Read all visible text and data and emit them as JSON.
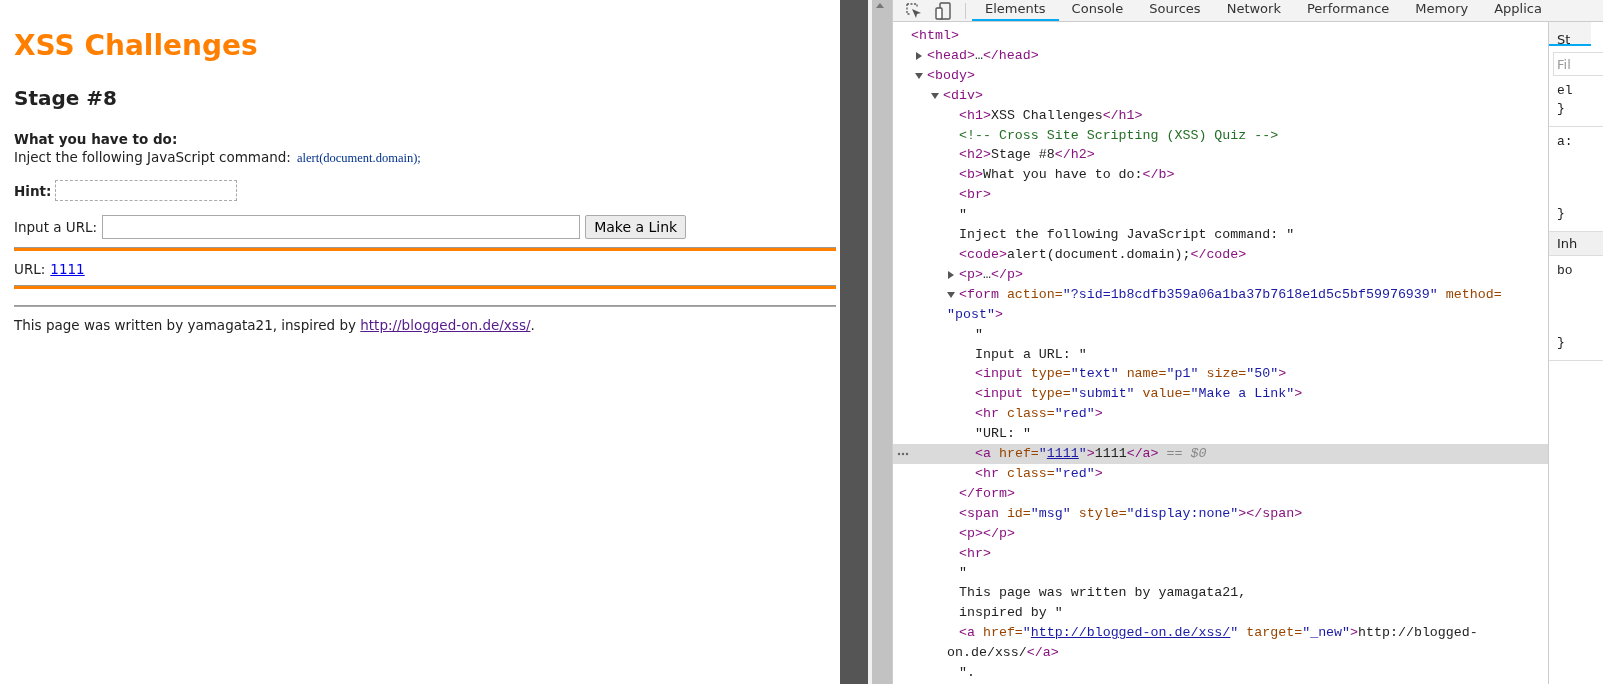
{
  "page": {
    "title": "XSS Challenges",
    "stage": "Stage #8",
    "task_label": "What you have to do:",
    "task_text": "Inject the following JavaScript command:",
    "task_code": "alert(document.domain);",
    "hint_label": "Hint:",
    "url_label": "Input a URL:",
    "button": "Make a Link",
    "result_label": "URL:",
    "result_link": "1111",
    "footer_text": "This page was written by yamagata21, inspired by",
    "footer_link": "http://blogged-on.de/xss/",
    "footer_end": "."
  },
  "devtools": {
    "tabs": [
      {
        "label": "Elements",
        "selected": true
      },
      {
        "label": "Console",
        "selected": false
      },
      {
        "label": "Sources",
        "selected": false
      },
      {
        "label": "Network",
        "selected": false
      },
      {
        "label": "Performance",
        "selected": false
      },
      {
        "label": "Memory",
        "selected": false
      },
      {
        "label": "Applica",
        "selected": false
      }
    ],
    "tree": [
      {
        "selected": false,
        "tokens": [
          {
            "kind": "tag",
            "text": "<html>"
          }
        ],
        "children": [
          {
            "selected": false,
            "expanded": false,
            "tokens": [
              {
                "kind": "tag",
                "text": "<head>"
              },
              {
                "kind": "text",
                "text": "…"
              },
              {
                "kind": "tag",
                "text": "</head>"
              }
            ]
          },
          {
            "selected": false,
            "expanded": true,
            "tokens": [
              {
                "kind": "tag",
                "text": "<body>"
              }
            ],
            "children": [
              {
                "selected": false,
                "expanded": true,
                "tokens": [
                  {
                    "kind": "tag",
                    "text": "<div>"
                  }
                ],
                "children": [
                  {
                    "selected": false,
                    "tokens": [
                      {
                        "kind": "tag",
                        "text": "<h1>"
                      },
                      {
                        "kind": "text",
                        "text": "XSS Challenges"
                      },
                      {
                        "kind": "tag",
                        "text": "</h1>"
                      }
                    ]
                  },
                  {
                    "selected": false,
                    "tokens": [
                      {
                        "kind": "comment",
                        "text": "<!-- Cross Site Scripting (XSS) Quiz -->"
                      }
                    ]
                  },
                  {
                    "selected": false,
                    "tokens": [
                      {
                        "kind": "tag",
                        "text": "<h2>"
                      },
                      {
                        "kind": "text",
                        "text": "Stage #8"
                      },
                      {
                        "kind": "tag",
                        "text": "</h2>"
                      }
                    ]
                  },
                  {
                    "selected": false,
                    "tokens": [
                      {
                        "kind": "tag",
                        "text": "<b>"
                      },
                      {
                        "kind": "text",
                        "text": "What you have to do:"
                      },
                      {
                        "kind": "tag",
                        "text": "</b>"
                      }
                    ]
                  },
                  {
                    "selected": false,
                    "tokens": [
                      {
                        "kind": "tag",
                        "text": "<br>"
                      }
                    ]
                  },
                  {
                    "selected": false,
                    "tokens": [
                      {
                        "kind": "text",
                        "text": "\""
                      }
                    ]
                  },
                  {
                    "selected": false,
                    "tokens": [
                      {
                        "kind": "text",
                        "text": "Inject the following JavaScript command: \""
                      }
                    ]
                  },
                  {
                    "selected": false,
                    "tokens": [
                      {
                        "kind": "tag",
                        "text": "<code>"
                      },
                      {
                        "kind": "text",
                        "text": "alert(document.domain);"
                      },
                      {
                        "kind": "tag",
                        "text": "</code>"
                      }
                    ]
                  },
                  {
                    "selected": false,
                    "expanded": false,
                    "tokens": [
                      {
                        "kind": "tag",
                        "text": "<p>"
                      },
                      {
                        "kind": "text",
                        "text": "…"
                      },
                      {
                        "kind": "tag",
                        "text": "</p>"
                      }
                    ]
                  },
                  {
                    "selected": false,
                    "expanded": true,
                    "tokens": [
                      {
                        "kind": "tag",
                        "text": "<form "
                      },
                      {
                        "kind": "attr",
                        "text": "action="
                      },
                      {
                        "kind": "value",
                        "text": "\"?sid=1b8cdfb359a06a1ba37b7618e1d5c5bf59976939\""
                      },
                      {
                        "kind": "attr",
                        "text": " method="
                      },
                      {
                        "kind": "value",
                        "text": "\"post\""
                      },
                      {
                        "kind": "tag",
                        "text": ">"
                      }
                    ],
                    "close": "</form>",
                    "children": [
                      {
                        "selected": false,
                        "tokens": [
                          {
                            "kind": "text",
                            "text": "\""
                          }
                        ]
                      },
                      {
                        "selected": false,
                        "tokens": [
                          {
                            "kind": "text",
                            "text": "Input a URL: \""
                          }
                        ]
                      },
                      {
                        "selected": false,
                        "tokens": [
                          {
                            "kind": "tag",
                            "text": "<input "
                          },
                          {
                            "kind": "attr",
                            "text": "type="
                          },
                          {
                            "kind": "value",
                            "text": "\"text\""
                          },
                          {
                            "kind": "attr",
                            "text": " name="
                          },
                          {
                            "kind": "value",
                            "text": "\"p1\""
                          },
                          {
                            "kind": "attr",
                            "text": " size="
                          },
                          {
                            "kind": "value",
                            "text": "\"50\""
                          },
                          {
                            "kind": "tag",
                            "text": ">"
                          }
                        ]
                      },
                      {
                        "selected": false,
                        "tokens": [
                          {
                            "kind": "tag",
                            "text": "<input "
                          },
                          {
                            "kind": "attr",
                            "text": "type="
                          },
                          {
                            "kind": "value",
                            "text": "\"submit\""
                          },
                          {
                            "kind": "attr",
                            "text": " value="
                          },
                          {
                            "kind": "value",
                            "text": "\"Make a Link\""
                          },
                          {
                            "kind": "tag",
                            "text": ">"
                          }
                        ]
                      },
                      {
                        "selected": false,
                        "tokens": [
                          {
                            "kind": "tag",
                            "text": "<hr "
                          },
                          {
                            "kind": "attr",
                            "text": "class="
                          },
                          {
                            "kind": "value",
                            "text": "\"red\""
                          },
                          {
                            "kind": "tag",
                            "text": ">"
                          }
                        ]
                      },
                      {
                        "selected": false,
                        "tokens": [
                          {
                            "kind": "text",
                            "text": "\"URL: \""
                          }
                        ]
                      },
                      {
                        "selected": true,
                        "tokens": [
                          {
                            "kind": "tag",
                            "text": "<a "
                          },
                          {
                            "kind": "attr",
                            "text": "href="
                          },
                          {
                            "kind": "value",
                            "text": "\""
                          },
                          {
                            "kind": "link",
                            "text": "1111"
                          },
                          {
                            "kind": "value",
                            "text": "\""
                          },
                          {
                            "kind": "tag",
                            "text": ">"
                          },
                          {
                            "kind": "text",
                            "text": "1111"
                          },
                          {
                            "kind": "tag",
                            "text": "</a>"
                          },
                          {
                            "kind": "hint",
                            "text": " == $0"
                          }
                        ]
                      },
                      {
                        "selected": false,
                        "tokens": [
                          {
                            "kind": "tag",
                            "text": "<hr "
                          },
                          {
                            "kind": "attr",
                            "text": "class="
                          },
                          {
                            "kind": "value",
                            "text": "\"red\""
                          },
                          {
                            "kind": "tag",
                            "text": ">"
                          }
                        ]
                      }
                    ]
                  },
                  {
                    "selected": false,
                    "tokens": [
                      {
                        "kind": "tag",
                        "text": "<span "
                      },
                      {
                        "kind": "attr",
                        "text": "id="
                      },
                      {
                        "kind": "value",
                        "text": "\"msg\""
                      },
                      {
                        "kind": "attr",
                        "text": " style="
                      },
                      {
                        "kind": "value",
                        "text": "\"display:none\""
                      },
                      {
                        "kind": "tag",
                        "text": "></span>"
                      }
                    ]
                  },
                  {
                    "selected": false,
                    "tokens": [
                      {
                        "kind": "tag",
                        "text": "<p></p>"
                      }
                    ]
                  },
                  {
                    "selected": false,
                    "tokens": [
                      {
                        "kind": "tag",
                        "text": "<hr>"
                      }
                    ]
                  },
                  {
                    "selected": false,
                    "tokens": [
                      {
                        "kind": "text",
                        "text": "\""
                      }
                    ]
                  },
                  {
                    "selected": false,
                    "tokens": [
                      {
                        "kind": "text",
                        "text": "This page was written by yamagata21,"
                      }
                    ]
                  },
                  {
                    "selected": false,
                    "tokens": [
                      {
                        "kind": "text",
                        "text": "inspired by \""
                      }
                    ]
                  },
                  {
                    "selected": false,
                    "tokens": [
                      {
                        "kind": "tag",
                        "text": "<a "
                      },
                      {
                        "kind": "attr",
                        "text": "href="
                      },
                      {
                        "kind": "value",
                        "text": "\""
                      },
                      {
                        "kind": "link",
                        "text": "http://blogged-on.de/xss/"
                      },
                      {
                        "kind": "value",
                        "text": "\""
                      },
                      {
                        "kind": "attr",
                        "text": " target="
                      },
                      {
                        "kind": "value",
                        "text": "\"_new\""
                      },
                      {
                        "kind": "tag",
                        "text": ">"
                      },
                      {
                        "kind": "text",
                        "text": "http://blogged-on.de/xss/"
                      },
                      {
                        "kind": "tag",
                        "text": "</a>"
                      }
                    ]
                  },
                  {
                    "selected": false,
                    "tokens": [
                      {
                        "kind": "text",
                        "text": "\"."
                      }
                    ]
                  }
                ]
              }
            ]
          }
        ]
      }
    ],
    "styles_pane": {
      "tab": "St",
      "filter_placeholder": "Fil",
      "rules": [
        {
          "lines": [
            "el",
            "}"
          ]
        },
        {
          "lines": [
            "a:",
            "}"
          ]
        }
      ],
      "inherited_header": "Inh",
      "inherited_rules": [
        {
          "lines": [
            "bo",
            "}"
          ]
        }
      ]
    }
  }
}
